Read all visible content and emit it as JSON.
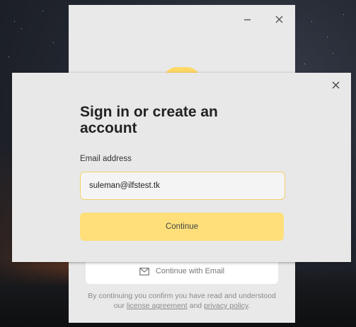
{
  "background_window": {
    "minimize_icon": "minimize-icon",
    "close_icon": "close-icon",
    "continue_with_email_label": "Continue with Email",
    "legal": {
      "prefix": "By continuing you confirm you have read and understood our",
      "license_link": "license agreement",
      "and": "and",
      "privacy_link": "privacy policy",
      "suffix": "."
    }
  },
  "modal": {
    "close_icon": "close-icon",
    "title": "Sign in or create an account",
    "email_label": "Email address",
    "email_value": "suleman@ilfstest.tk",
    "continue_label": "Continue"
  },
  "colors": {
    "accent": "#fedf7a",
    "input_border": "#f1d16b",
    "panel": "#e8e8e8"
  }
}
